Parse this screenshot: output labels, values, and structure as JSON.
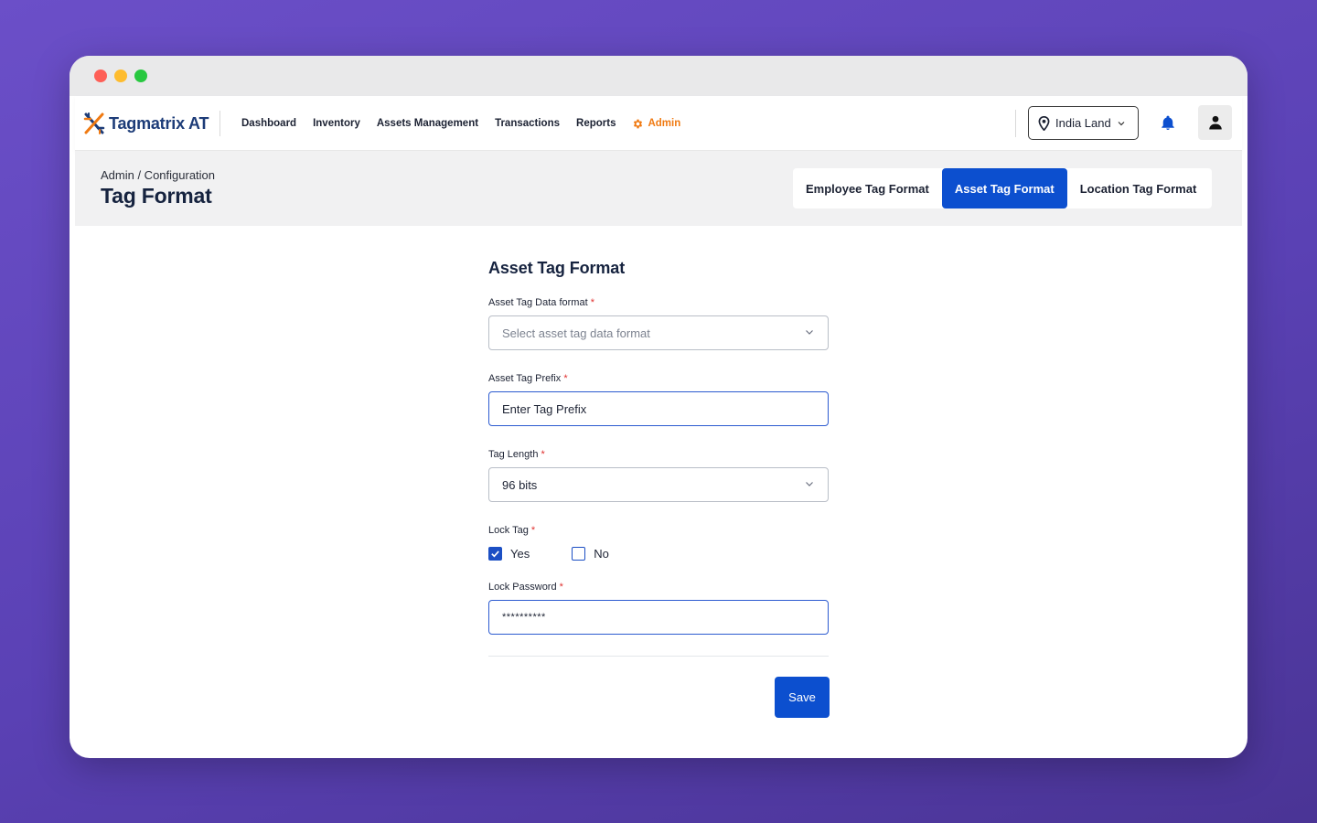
{
  "brand": {
    "name": "Tagmatrix AT"
  },
  "nav": {
    "items": [
      "Dashboard",
      "Inventory",
      "Assets Management",
      "Transactions",
      "Reports"
    ],
    "admin_label": "Admin"
  },
  "location": {
    "value": "India Land"
  },
  "header": {
    "breadcrumb": "Admin / Configuration",
    "title": "Tag Format",
    "tabs": [
      "Employee Tag Format",
      "Asset Tag Format",
      "Location Tag Format"
    ],
    "active_tab": "Asset Tag Format"
  },
  "form": {
    "title": "Asset Tag Format",
    "data_format_label": "Asset Tag Data format",
    "data_format_placeholder": "Select asset tag data format",
    "prefix_label": "Asset Tag Prefix",
    "prefix_value": "Enter Tag Prefix",
    "tag_length_label": "Tag Length",
    "tag_length_value": "96 bits",
    "lock_tag_label": "Lock Tag",
    "lock_yes": "Yes",
    "lock_no": "No",
    "lock_selected": "Yes",
    "password_label": "Lock Password",
    "password_value": "**********",
    "required_marker": "*",
    "save_label": "Save"
  },
  "colors": {
    "primary": "#0c4fcf",
    "admin_accent": "#f07a12",
    "required": "#e0302f"
  }
}
